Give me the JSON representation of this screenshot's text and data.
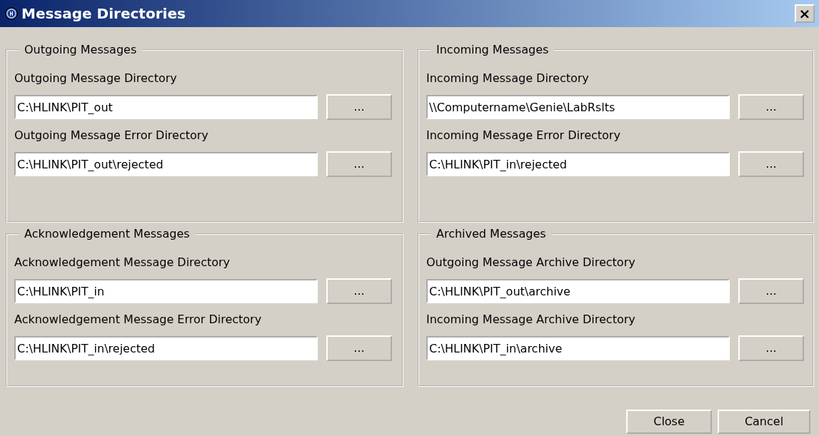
{
  "window": {
    "title": "Message Directories",
    "close_button": "×"
  },
  "groups": [
    {
      "title": "Outgoing Messages",
      "fields": [
        {
          "label": "Outgoing Message Directory",
          "value": "C:\\HLINK\\PIT_out",
          "button": "..."
        },
        {
          "label": "Outgoing Message Error Directory",
          "value": "C:\\HLINK\\PIT_out\\rejected",
          "button": "..."
        }
      ]
    },
    {
      "title": "Incoming Messages",
      "fields": [
        {
          "label": "Incoming Message Directory",
          "value": "\\\\Computername\\Genie\\LabRslts",
          "button": "..."
        },
        {
          "label": "Incoming Message Error Directory",
          "value": "C:\\HLINK\\PIT_in\\rejected",
          "button": "..."
        }
      ]
    },
    {
      "title": "Acknowledgement Messages",
      "fields": [
        {
          "label": "Acknowledgement Message Directory",
          "value": "C:\\HLINK\\PIT_in",
          "button": "..."
        },
        {
          "label": "Acknowledgement Message Error Directory",
          "value": "C:\\HLINK\\PIT_in\\rejected",
          "button": "..."
        }
      ]
    },
    {
      "title": "Archived Messages",
      "fields": [
        {
          "label": "Outgoing Message Archive Directory",
          "value": "C:\\HLINK\\PIT_out\\archive",
          "button": "..."
        },
        {
          "label": "Incoming Message Archive Directory",
          "value": "C:\\HLINK\\PIT_in\\archive",
          "button": "..."
        }
      ]
    }
  ],
  "buttons": [
    "Close",
    "Cancel"
  ]
}
